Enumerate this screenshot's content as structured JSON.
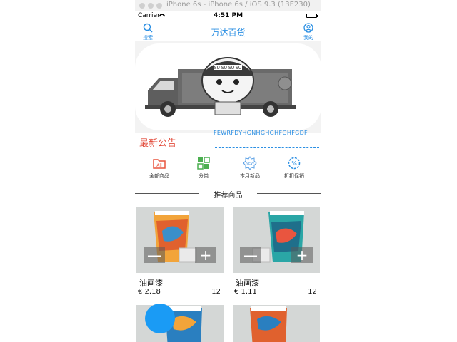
{
  "window": {
    "title": "iPhone 6s - iPhone 6s / iOS 9.3 (13E230)"
  },
  "status_bar": {
    "carrier": "Carrier",
    "time": "4:51 PM"
  },
  "navbar": {
    "title": "万达百货",
    "search_label": "搜索",
    "profile_label": "我的"
  },
  "banner": {
    "page_indicator": "0",
    "truck_text": "SU SU SU SU"
  },
  "notice": {
    "title": "最新公告",
    "marquee_text": "FEWRFDYHGNHGHGHFGHFGDF"
  },
  "categories": [
    {
      "label": "全部商品",
      "icon": "folder-all-icon",
      "color": "#e9553f"
    },
    {
      "label": "分类",
      "icon": "grid-icon",
      "color": "#4caf50"
    },
    {
      "label": "本月新品",
      "icon": "new-badge-icon",
      "color": "#5aa0e6"
    },
    {
      "label": "折扣促销",
      "icon": "discount-gear-icon",
      "color": "#2b8fe3"
    }
  ],
  "section": {
    "title": "推荐商品"
  },
  "products": [
    {
      "name": "油画漆",
      "price": "€ 2.18",
      "count": "12",
      "minus": "—",
      "plus": "+"
    },
    {
      "name": "油画漆",
      "price": "€ 1.11",
      "count": "12",
      "minus": "—",
      "plus": "+"
    }
  ],
  "colors": {
    "accent": "#2b8fe3",
    "notice": "#e24a3a",
    "fab": "#1a9bf5"
  }
}
